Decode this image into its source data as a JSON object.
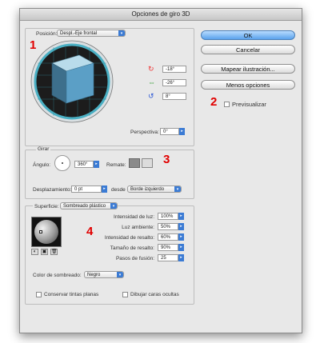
{
  "window": {
    "title": "Opciones de giro 3D"
  },
  "position": {
    "label": "Posición:",
    "value": "Despl.-Eje frontal"
  },
  "rotation": {
    "x": "-18°",
    "y": "-26°",
    "z": "8°"
  },
  "perspective": {
    "label": "Perspectiva:",
    "value": "0°"
  },
  "buttons": {
    "ok": "OK",
    "cancel": "Cancelar",
    "map": "Mapear ilustración...",
    "fewer": "Menos opciones",
    "preview": "Previsualizar"
  },
  "extrude": {
    "title": "Girar",
    "angle_label": "Ángulo:",
    "angle_value": "360°",
    "cap_label": "Remate:",
    "offset_label": "Desplazamiento:",
    "offset_value": "0 pt",
    "from_label": "desde",
    "from_value": "Borde izquierdo"
  },
  "surface": {
    "label": "Superficie:",
    "value": "Sombreado plástico",
    "params": [
      {
        "label": "Intensidad de luz:",
        "value": "100%"
      },
      {
        "label": "Luz ambiente:",
        "value": "50%"
      },
      {
        "label": "Intensidad de resalto:",
        "value": "60%"
      },
      {
        "label": "Tamaño de resalto:",
        "value": "90%"
      },
      {
        "label": "Pasos de fusión:",
        "value": "25"
      }
    ],
    "shading_label": "Color de sombreado:",
    "shading_value": "Negro",
    "preserve_spot": "Conservar tintas planas",
    "hidden_faces": "Dibujar caras ocultas"
  },
  "markers": [
    "1",
    "2",
    "3",
    "4"
  ],
  "colors": {
    "accent": "#3b7bd4",
    "marker": "#e10000",
    "cube_front": "#5b9fc6",
    "cube_top": "#b9dceb",
    "track_ring": "#4ab0c4"
  }
}
